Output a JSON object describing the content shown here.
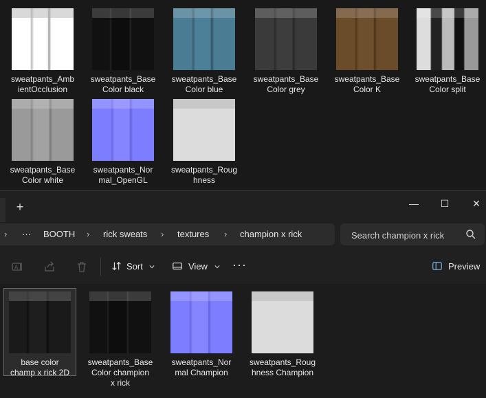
{
  "top_pane": {
    "files": [
      {
        "label": "sweatpants_Amb\nientOcclusion",
        "thumb": "ao"
      },
      {
        "label": "sweatpants_Base\nColor black",
        "thumb": "black"
      },
      {
        "label": "sweatpants_Base\nColor blue",
        "thumb": "blue"
      },
      {
        "label": "sweatpants_Base\nColor grey",
        "thumb": "grey"
      },
      {
        "label": "sweatpants_Base\nColor K",
        "thumb": "k"
      },
      {
        "label": "sweatpants_Base\nColor split",
        "thumb": "split"
      },
      {
        "label": "sweatpants_Base\nColor white",
        "thumb": "white"
      },
      {
        "label": "sweatpants_Nor\nmal_OpenGL",
        "thumb": "normal"
      },
      {
        "label": "sweatpants_Roug\nhness",
        "thumb": "rough"
      }
    ]
  },
  "titlebar": {
    "new_tab": "+",
    "minimize": "—",
    "maximize": "☐",
    "close": "✕"
  },
  "address": {
    "more": "···",
    "crumbs": [
      "BOOTH",
      "rick sweats",
      "textures",
      "champion x rick"
    ],
    "separator": "›",
    "search_placeholder": "Search champion x rick"
  },
  "commands": {
    "sort_label": "Sort",
    "view_label": "View",
    "more_label": "···",
    "preview_label": "Preview"
  },
  "bottom_pane": {
    "files": [
      {
        "label": "base color\nchamp x rick 2D",
        "thumb": "base2d",
        "selected": true
      },
      {
        "label": "sweatpants_Base\nColor champion\nx rick",
        "thumb": "black"
      },
      {
        "label": "sweatpants_Nor\nmal Champion",
        "thumb": "normal"
      },
      {
        "label": "sweatpants_Roug\nhness Champion",
        "thumb": "rough"
      }
    ]
  },
  "colors": {
    "background": "#1c1c1c",
    "chrome": "#202020",
    "field": "#2c2c2c",
    "text": "#e6e6e6"
  }
}
